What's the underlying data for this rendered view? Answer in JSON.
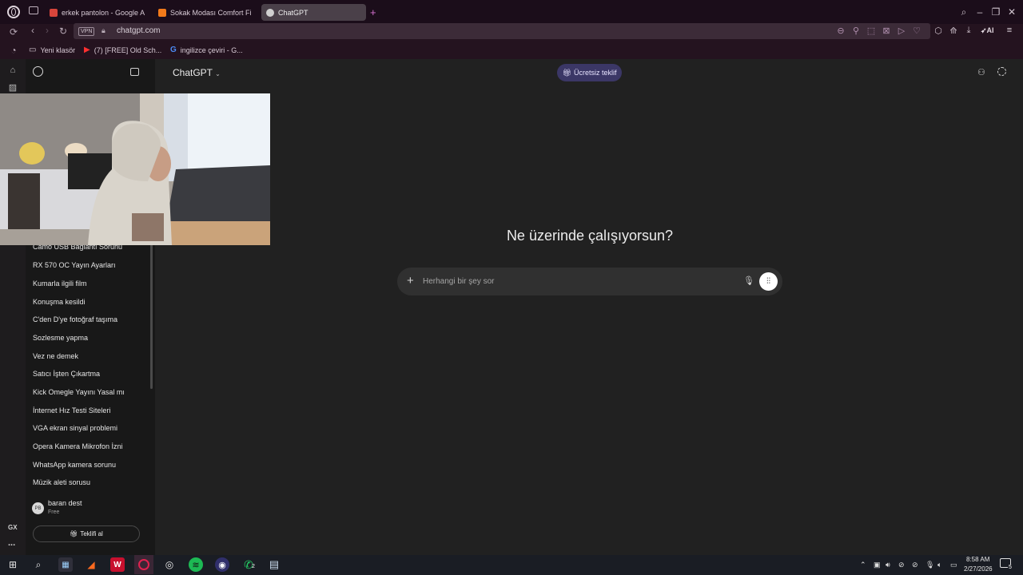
{
  "browser": {
    "tabs": [
      {
        "label": "erkek pantolon - Google A",
        "favicon_color": "#d8453b"
      },
      {
        "label": "Sokak Modası Comfort Fi",
        "favicon_color": "#f27a1a"
      },
      {
        "label": "ChatGPT",
        "favicon_color": "#d0d0d0",
        "active": true
      }
    ],
    "new_tab_label": "+",
    "vpn_label": "VPN",
    "url": "chatgpt.com",
    "ai_label": "AI",
    "bookmarks": [
      {
        "label": "Yeni klasör",
        "icon": "folder-icon"
      },
      {
        "label": "(7) [FREE] Old Sch...",
        "icon": "youtube-icon"
      },
      {
        "label": "ingilizce çeviri - G...",
        "icon": "google-icon"
      }
    ]
  },
  "chat": {
    "model_label": "ChatGPT",
    "offer_badge": "Ücretsiz teklif",
    "headline": "Ne üzerinde çalışıyorsun?",
    "composer_placeholder": "Herhangi bir şey sor",
    "history": [
      "Camo USB Bağlantı Sorunu",
      "RX 570 OC Yayın Ayarları",
      "Kumarla ilgili film",
      "Konuşma kesildi",
      "C'den D'ye fotoğraf taşıma",
      "Sozlesme yapma",
      "Vez ne demek",
      "Satıcı İşten Çıkartma",
      "Kick Omegle Yayını Yasal mı",
      "İnternet Hız Testi Siteleri",
      "VGA ekran sinyal problemi",
      "Opera Kamera Mikrofon İzni",
      "WhatsApp kamera sorunu",
      "Müzik aleti sorusu"
    ],
    "user": {
      "initials": "PB",
      "name": "baran dest",
      "plan": "Free"
    },
    "upgrade_button": "Teklifi al"
  },
  "rail": {
    "gx_label": "GX",
    "more_label": "..."
  },
  "taskbar": {
    "whatsapp_badge": "2",
    "time": "8:58 AM",
    "date": "2/27/2026",
    "notification_count": "5"
  }
}
